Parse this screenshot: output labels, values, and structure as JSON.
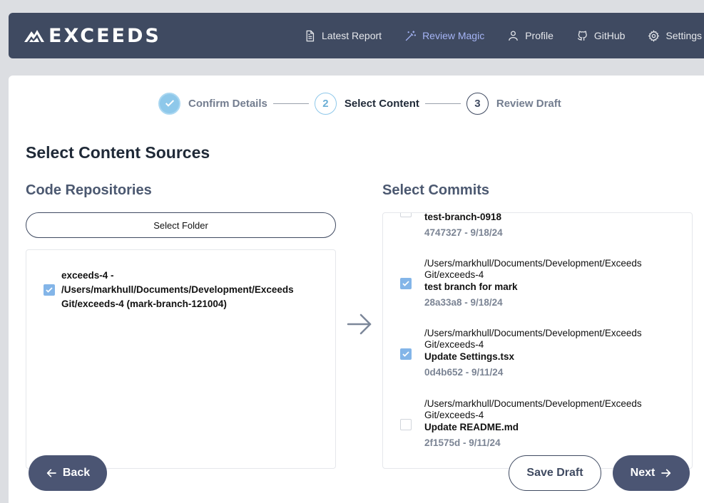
{
  "brand": {
    "name": "EXCEEDS"
  },
  "nav": {
    "items": [
      {
        "label": "Latest Report",
        "icon": "document-icon",
        "active": false
      },
      {
        "label": "Review Magic",
        "icon": "magic-wand-icon",
        "active": true
      },
      {
        "label": "Profile",
        "icon": "user-icon",
        "active": false
      },
      {
        "label": "GitHub",
        "icon": "github-icon",
        "active": false
      },
      {
        "label": "Settings",
        "icon": "gear-icon",
        "active": false
      }
    ]
  },
  "stepper": {
    "steps": [
      {
        "number": "",
        "label": "Confirm Details",
        "state": "done"
      },
      {
        "number": "2",
        "label": "Select Content",
        "state": "current"
      },
      {
        "number": "3",
        "label": "Review Draft",
        "state": "future"
      }
    ]
  },
  "page": {
    "title": "Select Content Sources"
  },
  "repositories": {
    "title": "Code Repositories",
    "select_folder_label": "Select Folder",
    "items": [
      {
        "label": "exceeds-4 - /Users/markhull/Documents/Development/Exceeds Git/exceeds-4 (mark-branch-121004)",
        "checked": true
      }
    ]
  },
  "commits": {
    "title": "Select Commits",
    "items": [
      {
        "path": "",
        "message": "test-branch-0918",
        "meta": "4747327 - 9/18/24",
        "checked": false
      },
      {
        "path": "/Users/markhull/Documents/Development/Exceeds Git/exceeds-4",
        "message": "test branch for mark",
        "meta": "28a33a8 - 9/18/24",
        "checked": true
      },
      {
        "path": "/Users/markhull/Documents/Development/Exceeds Git/exceeds-4",
        "message": "Update Settings.tsx",
        "meta": "0d4b652 - 9/11/24",
        "checked": true
      },
      {
        "path": "/Users/markhull/Documents/Development/Exceeds Git/exceeds-4",
        "message": "Update README.md",
        "meta": "2f1575d - 9/11/24",
        "checked": false
      }
    ]
  },
  "actions": {
    "back_label": "Back",
    "save_label": "Save Draft",
    "next_label": "Next"
  },
  "colors": {
    "navbar": "#3f4a61",
    "accent": "#8ec8ea",
    "checkbox": "#83b5e8",
    "primary_button": "#4b5573"
  }
}
